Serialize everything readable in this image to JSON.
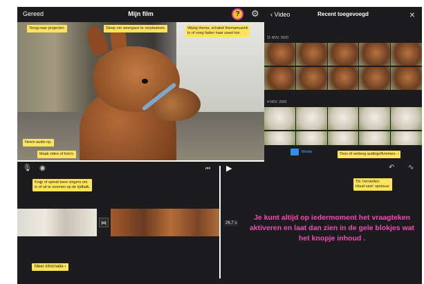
{
  "top": {
    "done_label": "Gereed",
    "title": "Mijn film"
  },
  "right_panel": {
    "back_label": "Video",
    "title": "Recent toegevoegd",
    "date1": "11 NOV. 2020",
    "date2": "4 NOV. 2020",
    "media_tab": "Media"
  },
  "tips": {
    "back": "Terug naar projecten.",
    "drag": "Sleep om weergave te verplaatsen.",
    "theme": "Wijzig thema, schakel themamuziek\nin of voeg faden naar zwart toe.",
    "audio": "Neem audio op.",
    "mask": "Maak video of foto's.",
    "pinch": "Knijp of spreid twee vingers om\nin of uit te zoomen op de tijdbalk.",
    "undo": "Tik: herstellen.\nHoud vast: opnieuw.",
    "waveform": "Toon of verberg audiogolfvormen.",
    "more": "Meer informatie"
  },
  "timeline": {
    "duration": "26,7 s"
  },
  "message": "Je kunt altijd op iedermoment  het vraagteken aktiveren en laat dan zien in de gele blokjes wat het knopje inhoud .",
  "colors": {
    "tip_bg": "#ffe45c",
    "help_button": "#f5c518",
    "help_ring": "#e23ab6",
    "message_text": "#f24ab8",
    "dark_ui": "#1c1c1e"
  }
}
